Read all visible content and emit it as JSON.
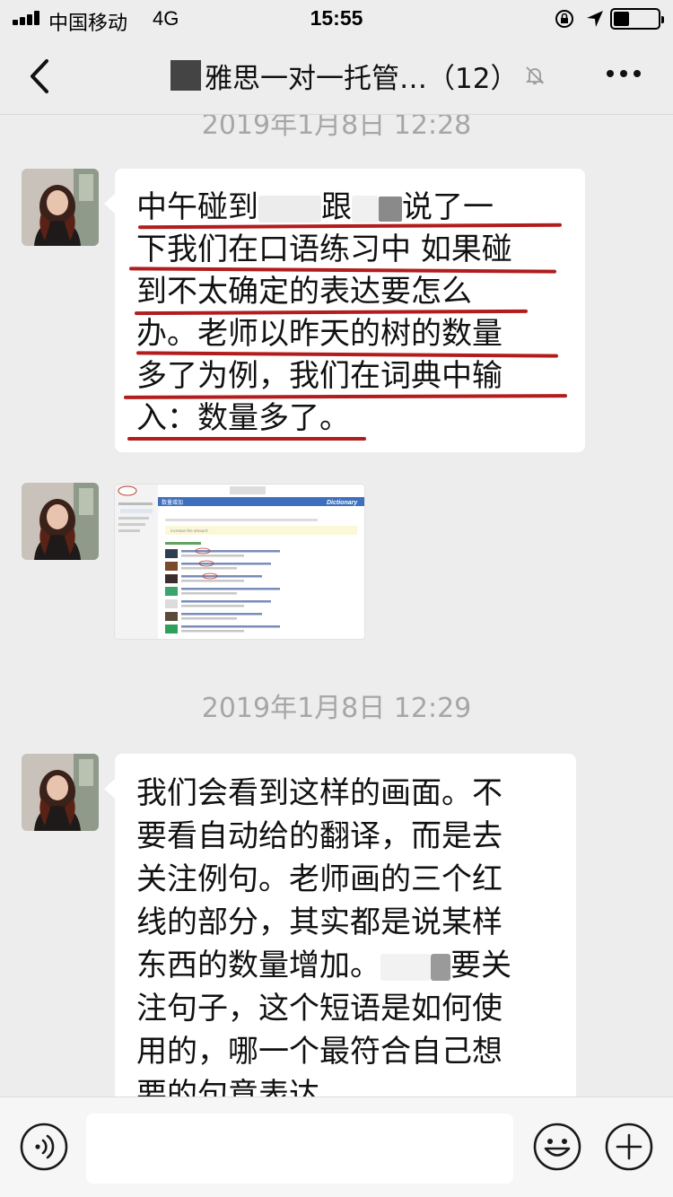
{
  "status_bar": {
    "carrier": "中国移动",
    "network": "4G",
    "time": "15:55",
    "battery_level": 0.35,
    "icons": [
      "rotation-lock-icon",
      "location-arrow-icon",
      "battery-icon"
    ]
  },
  "nav": {
    "title": "雅思一对一托管…（12）",
    "back_icon": "back-chevron-icon",
    "mute_icon": "muted-bell-icon",
    "more_icon": "more-dots-icon"
  },
  "messages": [
    {
      "timestamp": "2019年1月8日 12:28",
      "type": "text",
      "lines": [
        {
          "parts": [
            "中午碰到",
            "[redacted]",
            "跟",
            "[redacted]",
            "说了一"
          ]
        },
        {
          "parts": [
            "下我们在口语练习中 如果碰"
          ]
        },
        {
          "parts": [
            "到不太确定的表达要怎么"
          ]
        },
        {
          "parts": [
            "办。老师以昨天的树的数量"
          ]
        },
        {
          "parts": [
            "多了为例，我们在词典中输"
          ]
        },
        {
          "parts": [
            "入：数量多了。"
          ]
        }
      ]
    },
    {
      "type": "image",
      "image": {
        "header_title": "数量增加",
        "brand": "Dictionary",
        "search_box_text": "increase the amount",
        "example_rows": 7
      }
    },
    {
      "timestamp": "2019年1月8日 12:29",
      "type": "text",
      "lines": [
        {
          "parts": [
            "我们会看到这样的画面。不"
          ]
        },
        {
          "parts": [
            "要看自动给的翻译，而是去"
          ]
        },
        {
          "parts": [
            "关注例句。老师画的三个红"
          ]
        },
        {
          "parts": [
            "线的部分，其实都是说某样"
          ]
        },
        {
          "parts": [
            "东西的数量增加。",
            "[redacted]",
            "要关"
          ]
        },
        {
          "parts": [
            "注句子，这个短语是如何使"
          ]
        },
        {
          "parts": [
            "用的，哪一个最符合自己想"
          ]
        },
        {
          "parts": [
            "要的句意表达。"
          ]
        }
      ]
    }
  ],
  "input_bar": {
    "voice_icon": "voice-icon",
    "emoji_icon": "emoji-icon",
    "plus_icon": "plus-icon"
  },
  "colors": {
    "background": "#ededed",
    "bubble": "#ffffff",
    "underline_red": "#b21c1c",
    "timestamp": "#a6a6a6"
  }
}
